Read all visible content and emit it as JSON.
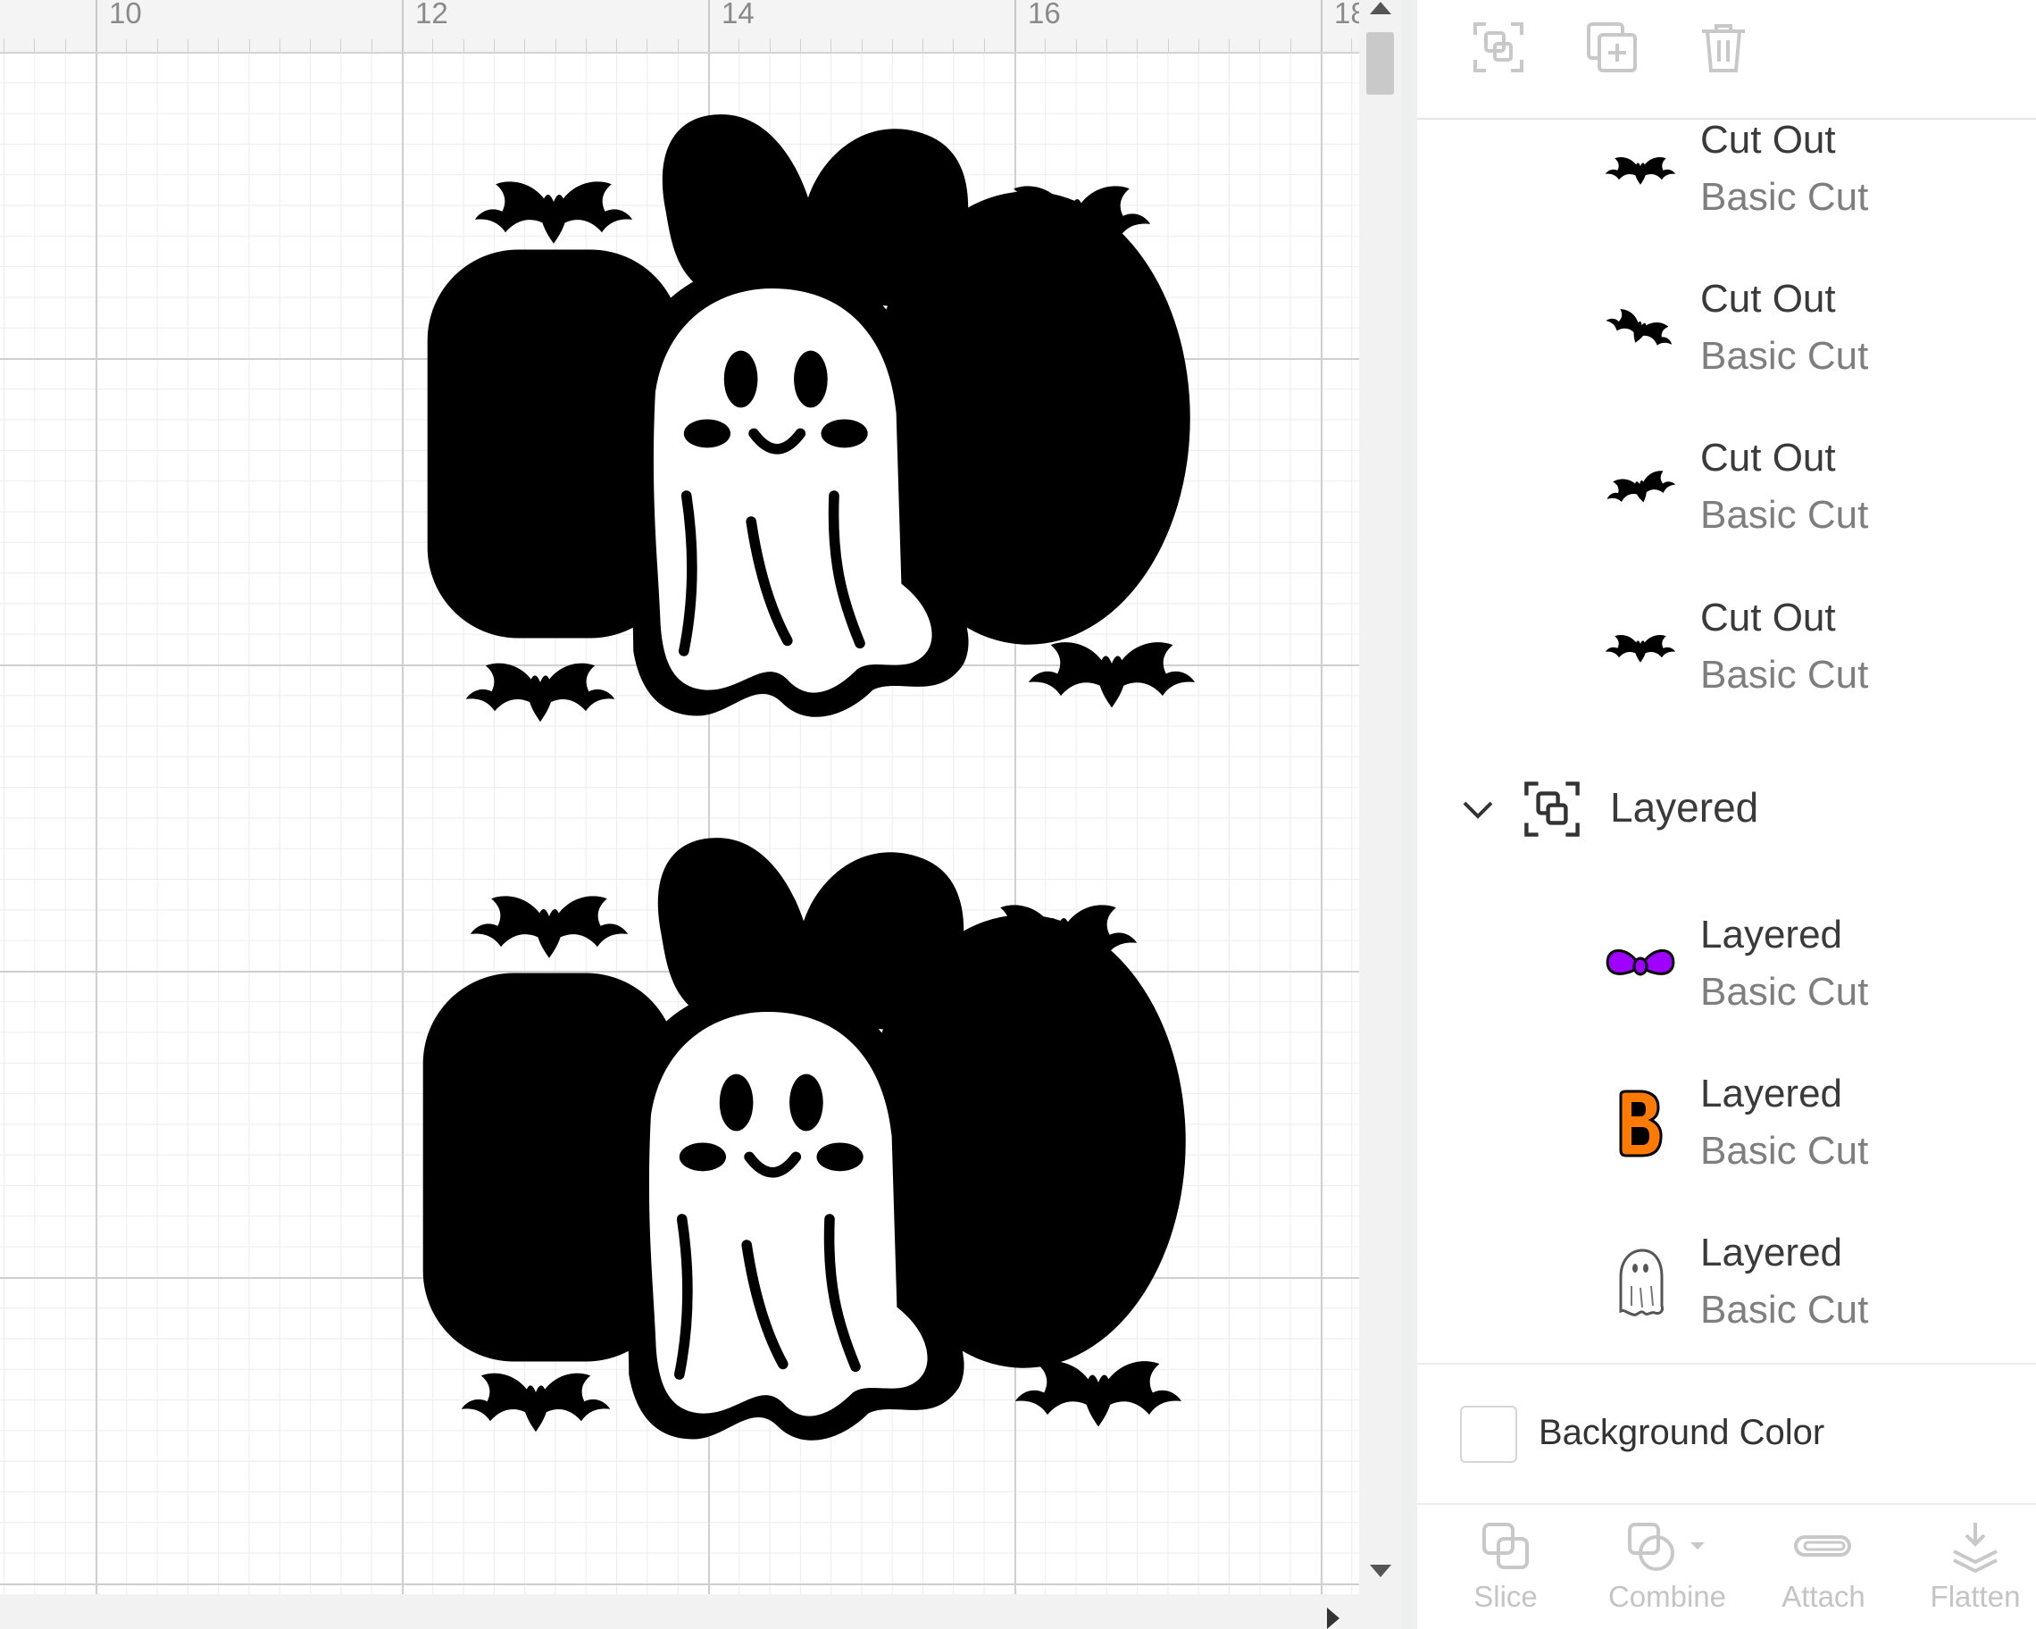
{
  "ruler": {
    "labels": [
      "10",
      "12",
      "14",
      "16",
      "18"
    ]
  },
  "panel": {
    "toolbar": {
      "group_icon": "group-icon",
      "duplicate_icon": "duplicate-icon",
      "delete_icon": "trash-icon"
    },
    "cutout_layers": [
      {
        "name": "Cut Out",
        "operation": "Basic Cut",
        "thumb": "bat-icon"
      },
      {
        "name": "Cut Out",
        "operation": "Basic Cut",
        "thumb": "bat-icon"
      },
      {
        "name": "Cut Out",
        "operation": "Basic Cut",
        "thumb": "bat-icon"
      },
      {
        "name": "Cut Out",
        "operation": "Basic Cut",
        "thumb": "bat-icon"
      }
    ],
    "group": {
      "label": "Layered",
      "icon": "group-icon",
      "expanded": true
    },
    "layered_layers": [
      {
        "name": "Layered",
        "operation": "Basic Cut",
        "thumb": "bow-icon"
      },
      {
        "name": "Layered",
        "operation": "Basic Cut",
        "thumb": "letter-b-icon"
      },
      {
        "name": "Layered",
        "operation": "Basic Cut",
        "thumb": "ghost-icon"
      }
    ],
    "background": {
      "label": "Background Color",
      "color": "#ffffff"
    },
    "actions": [
      {
        "label": "Slice",
        "icon": "slice-icon"
      },
      {
        "label": "Combine",
        "icon": "combine-icon"
      },
      {
        "label": "Attach",
        "icon": "attach-icon"
      },
      {
        "label": "Flatten",
        "icon": "flatten-icon"
      }
    ]
  },
  "colors": {
    "orange": "#ff7a00",
    "purple": "#a000ff",
    "black": "#000000",
    "white": "#ffffff",
    "disabled": "#c4c4c4"
  }
}
